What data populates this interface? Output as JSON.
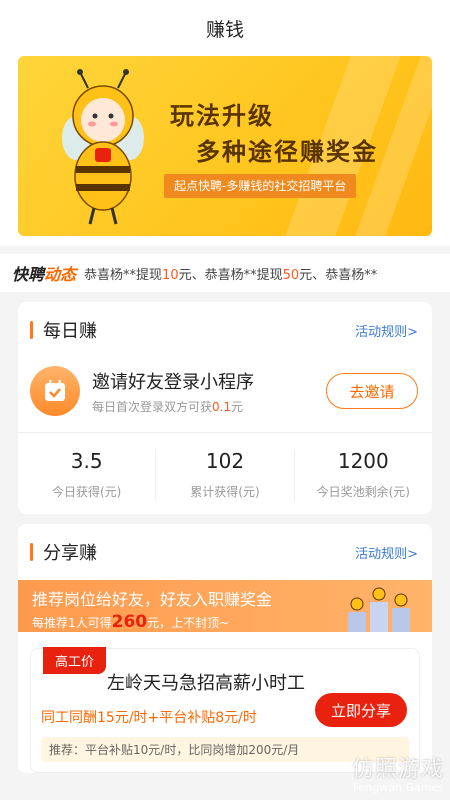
{
  "header": {
    "title": "赚钱"
  },
  "banner": {
    "line1": "玩法升级",
    "line2": "多种途径赚奖金",
    "tagline": "起点快聘-多赚钱的社交招聘平台"
  },
  "ticker": {
    "logo_a": "快聘",
    "logo_b": "动态",
    "items": [
      {
        "prefix": "恭喜杨**提现",
        "amount": "10",
        "suffix": "元、"
      },
      {
        "prefix": "恭喜杨**提现",
        "amount": "50",
        "suffix": "元、"
      },
      {
        "prefix": "恭喜杨**",
        "amount": "",
        "suffix": ""
      }
    ]
  },
  "daily": {
    "title": "每日赚",
    "rules_link": "活动规则>",
    "invite": {
      "title": "邀请好友登录小程序",
      "sub_prefix": "每日首次登录双方可获",
      "sub_amount": "0.1",
      "sub_suffix": "元",
      "button": "去邀请"
    },
    "stats": [
      {
        "value": "3.5",
        "label": "今日获得(元)"
      },
      {
        "value": "102",
        "label": "累计获得(元)"
      },
      {
        "value": "1200",
        "label": "今日奖池剩余(元)"
      }
    ]
  },
  "share": {
    "title": "分享赚",
    "rules_link": "活动规则>",
    "banner_line1": "推荐岗位给好友，好友入职赚奖金",
    "banner_line2_prefix": "每推荐1人可得",
    "banner_line2_amount": "260",
    "banner_line2_suffix": "元，上不封顶~",
    "job": {
      "tag": "高工价",
      "title": "左岭天马急招高薪小时工",
      "pay": "同工同酬15元/时+平台补贴8元/时",
      "note": "推荐：平台补贴10元/时，比同岗增加200元/月",
      "button": "立即分享"
    }
  },
  "watermark": {
    "main": "仿照游戏",
    "sub": "Fengwan Games"
  },
  "colors": {
    "accent": "#ff6a00",
    "link": "#3a7bd5",
    "red": "#e8220f",
    "banner_bg": "#ffc51e"
  }
}
